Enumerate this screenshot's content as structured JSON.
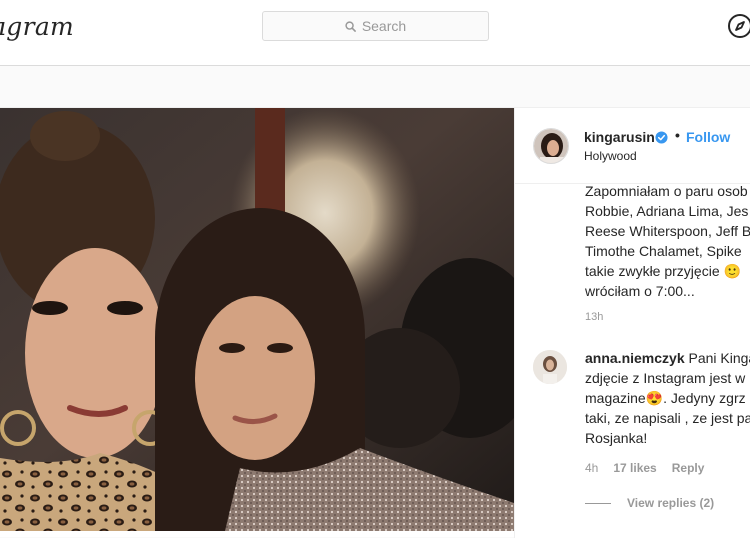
{
  "header": {
    "logo_text": "ıgram",
    "search_placeholder": "Search",
    "compass_icon": "compass-icon"
  },
  "post": {
    "author": {
      "username": "kingarusin",
      "verified": true,
      "dot": "•",
      "follow_label": "Follow",
      "location": "Holywood"
    },
    "caption": {
      "text": "Zapomniałam o paru osob\nRobbie, Adriana Lima, Jes\nReese Whiterspoon, Jeff B\nTimothe Chalamet, Spike\ntakie zwykłe przyjęcie 🙂\nwróciłam o 7:00...",
      "time": "13h"
    },
    "comment": {
      "username": "anna.niemczyk",
      "text": " Pani Kinga\nzdjęcie z Instagram jest w\nmagazine😍. Jedyny zgrz\ntaki, ze napisali , ze jest pa\nRosjanka!",
      "time": "4h",
      "likes": "17 likes",
      "reply_label": "Reply",
      "view_replies": "View replies (2)"
    }
  },
  "colors": {
    "accent": "#3897f0",
    "border": "#dbdbdb",
    "muted": "#999999"
  }
}
